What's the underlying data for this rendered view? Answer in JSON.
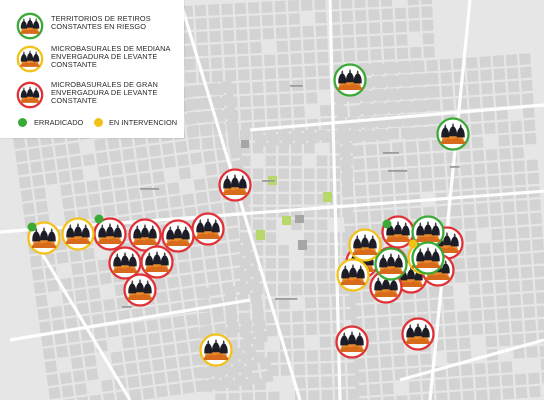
{
  "legend": {
    "items": [
      {
        "label": "TERRITORIOS DE RETIROS CONSTANTES EN RIESGO",
        "color": "#3aa935"
      },
      {
        "label": "MICROBASURALES DE MEDIANA ENVERGADURA DE LEVANTE CONSTANTE",
        "color": "#f2c21b"
      },
      {
        "label": "MICROBASURALES DE GRAN ENVERGADURA DE LEVANTE CONSTANTE",
        "color": "#e03137"
      }
    ],
    "dots": [
      {
        "label": "ERRADICADO",
        "color": "#3aa935"
      },
      {
        "label": "EN INTERVENCION",
        "color": "#f2c21b"
      }
    ]
  },
  "map": {
    "colors": {
      "background": "#e6e6e6",
      "street": "#ffffff",
      "block": "#d3d3d3",
      "park": "#b9d86b",
      "plaza": "#a6a6a6"
    },
    "icon": "garbage-pile-icon",
    "markers": [
      {
        "type": "red"
      },
      {
        "type": "red"
      },
      {
        "type": "red"
      },
      {
        "type": "red"
      },
      {
        "type": "red"
      },
      {
        "type": "red"
      },
      {
        "type": "red"
      },
      {
        "type": "red"
      },
      {
        "type": "red"
      },
      {
        "type": "red"
      },
      {
        "type": "red"
      },
      {
        "type": "red"
      },
      {
        "type": "red"
      },
      {
        "type": "red"
      },
      {
        "type": "red"
      },
      {
        "type": "red"
      },
      {
        "type": "red"
      },
      {
        "type": "yellow"
      },
      {
        "type": "yellow"
      },
      {
        "type": "yellow"
      },
      {
        "type": "yellow"
      },
      {
        "type": "yellow"
      },
      {
        "type": "yellow"
      },
      {
        "type": "green"
      },
      {
        "type": "green"
      },
      {
        "type": "green"
      },
      {
        "type": "green"
      },
      {
        "type": "green"
      }
    ],
    "status_dots": [
      {
        "status": "erradicado"
      },
      {
        "status": "erradicado"
      },
      {
        "status": "erradicado"
      },
      {
        "status": "en_intervencion"
      }
    ]
  }
}
